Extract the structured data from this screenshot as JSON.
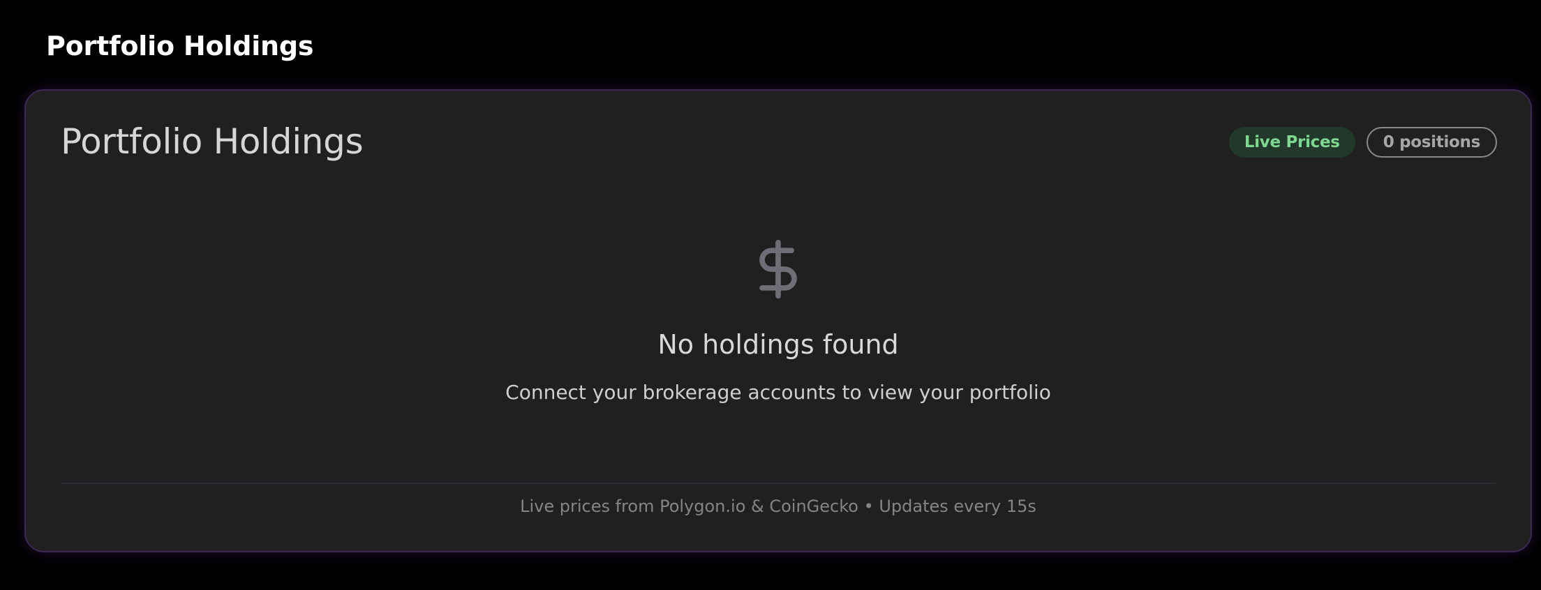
{
  "page": {
    "title": "Portfolio Holdings"
  },
  "card": {
    "title": "Portfolio Holdings",
    "badges": {
      "live": "Live Prices",
      "positions": "0 positions"
    },
    "empty_state": {
      "icon": "dollar-icon",
      "title": "No holdings found",
      "subtitle": "Connect your brokerage accounts to view your portfolio"
    },
    "footer": "Live prices from Polygon.io & CoinGecko • Updates every 15s"
  },
  "colors": {
    "background": "#000000",
    "card_background": "#202020",
    "card_border_glow": "#3b2a52",
    "live_badge_text": "#7fd891",
    "live_badge_bg": "#22382a"
  }
}
